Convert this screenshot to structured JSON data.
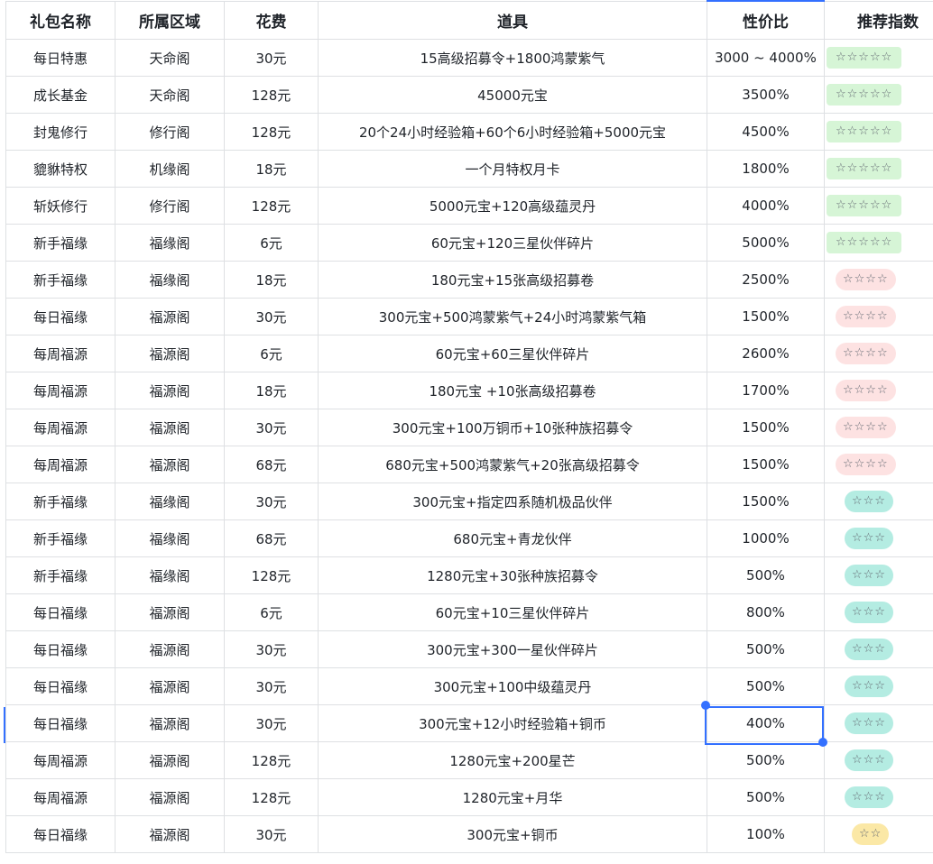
{
  "columns": [
    "礼包名称",
    "所属区域",
    "花费",
    "道具",
    "性价比",
    "推荐指数"
  ],
  "rows": [
    {
      "name": "每日特惠",
      "area": "天命阁",
      "cost": "30元",
      "items": "15高级招募令+1800鸿蒙紫气",
      "value": "3000 ~ 4000%",
      "rating": "☆☆☆☆☆",
      "color": "green"
    },
    {
      "name": "成长基金",
      "area": "天命阁",
      "cost": "128元",
      "items": "45000元宝",
      "value": "3500%",
      "rating": "☆☆☆☆☆",
      "color": "green"
    },
    {
      "name": "封鬼修行",
      "area": "修行阁",
      "cost": "128元",
      "items": "20个24小时经验箱+60个6小时经验箱+5000元宝",
      "value": "4500%",
      "rating": "☆☆☆☆☆",
      "color": "green"
    },
    {
      "name": "貔貅特权",
      "area": "机缘阁",
      "cost": "18元",
      "items": "一个月特权月卡",
      "value": "1800%",
      "rating": "☆☆☆☆☆",
      "color": "green"
    },
    {
      "name": "斩妖修行",
      "area": "修行阁",
      "cost": "128元",
      "items": "5000元宝+120高级蕴灵丹",
      "value": "4000%",
      "rating": "☆☆☆☆☆",
      "color": "green"
    },
    {
      "name": "新手福缘",
      "area": "福缘阁",
      "cost": "6元",
      "items": "60元宝+120三星伙伴碎片",
      "value": "5000%",
      "rating": "☆☆☆☆☆",
      "color": "green"
    },
    {
      "name": "新手福缘",
      "area": "福缘阁",
      "cost": "18元",
      "items": "180元宝+15张高级招募卷",
      "value": "2500%",
      "rating": "☆☆☆☆",
      "color": "pink"
    },
    {
      "name": "每日福缘",
      "area": "福源阁",
      "cost": "30元",
      "items": "300元宝+500鸿蒙紫气+24小时鸿蒙紫气箱",
      "value": "1500%",
      "rating": "☆☆☆☆",
      "color": "pink"
    },
    {
      "name": "每周福源",
      "area": "福源阁",
      "cost": "6元",
      "items": "60元宝+60三星伙伴碎片",
      "value": "2600%",
      "rating": "☆☆☆☆",
      "color": "pink"
    },
    {
      "name": "每周福源",
      "area": "福源阁",
      "cost": "18元",
      "items": "180元宝 +10张高级招募卷",
      "value": "1700%",
      "rating": "☆☆☆☆",
      "color": "pink"
    },
    {
      "name": "每周福源",
      "area": "福源阁",
      "cost": "30元",
      "items": "300元宝+100万铜币+10张种族招募令",
      "value": "1500%",
      "rating": "☆☆☆☆",
      "color": "pink"
    },
    {
      "name": "每周福源",
      "area": "福源阁",
      "cost": "68元",
      "items": "680元宝+500鸿蒙紫气+20张高级招募令",
      "value": "1500%",
      "rating": "☆☆☆☆",
      "color": "pink"
    },
    {
      "name": "新手福缘",
      "area": "福缘阁",
      "cost": "30元",
      "items": "300元宝+指定四系随机极品伙伴",
      "value": "1500%",
      "rating": "☆☆☆",
      "color": "teal"
    },
    {
      "name": "新手福缘",
      "area": "福缘阁",
      "cost": "68元",
      "items": "680元宝+青龙伙伴",
      "value": "1000%",
      "rating": "☆☆☆",
      "color": "teal"
    },
    {
      "name": "新手福缘",
      "area": "福缘阁",
      "cost": "128元",
      "items": "1280元宝+30张种族招募令",
      "value": "500%",
      "rating": "☆☆☆",
      "color": "teal"
    },
    {
      "name": "每日福缘",
      "area": "福源阁",
      "cost": "6元",
      "items": "60元宝+10三星伙伴碎片",
      "value": "800%",
      "rating": "☆☆☆",
      "color": "teal"
    },
    {
      "name": "每日福缘",
      "area": "福源阁",
      "cost": "30元",
      "items": "300元宝+300一星伙伴碎片",
      "value": "500%",
      "rating": "☆☆☆",
      "color": "teal"
    },
    {
      "name": "每日福缘",
      "area": "福源阁",
      "cost": "30元",
      "items": "300元宝+100中级蕴灵丹",
      "value": "500%",
      "rating": "☆☆☆",
      "color": "teal"
    },
    {
      "name": "每日福缘",
      "area": "福源阁",
      "cost": "30元",
      "items": "300元宝+12小时经验箱+铜币",
      "value": "400%",
      "rating": "☆☆☆",
      "color": "teal",
      "selected": true
    },
    {
      "name": "每周福源",
      "area": "福源阁",
      "cost": "128元",
      "items": "1280元宝+200星芒",
      "value": "500%",
      "rating": "☆☆☆",
      "color": "teal"
    },
    {
      "name": "每周福源",
      "area": "福源阁",
      "cost": "128元",
      "items": "1280元宝+月华",
      "value": "500%",
      "rating": "☆☆☆",
      "color": "teal"
    },
    {
      "name": "每日福缘",
      "area": "福源阁",
      "cost": "30元",
      "items": "300元宝+铜币",
      "value": "100%",
      "rating": "☆☆",
      "color": "yellow"
    }
  ],
  "badge_colors": {
    "green": "#d6f5d6",
    "pink": "#fde2e2",
    "teal": "#b4ece2",
    "yellow": "#fbe8a6"
  },
  "selection_color": "#3370ff"
}
